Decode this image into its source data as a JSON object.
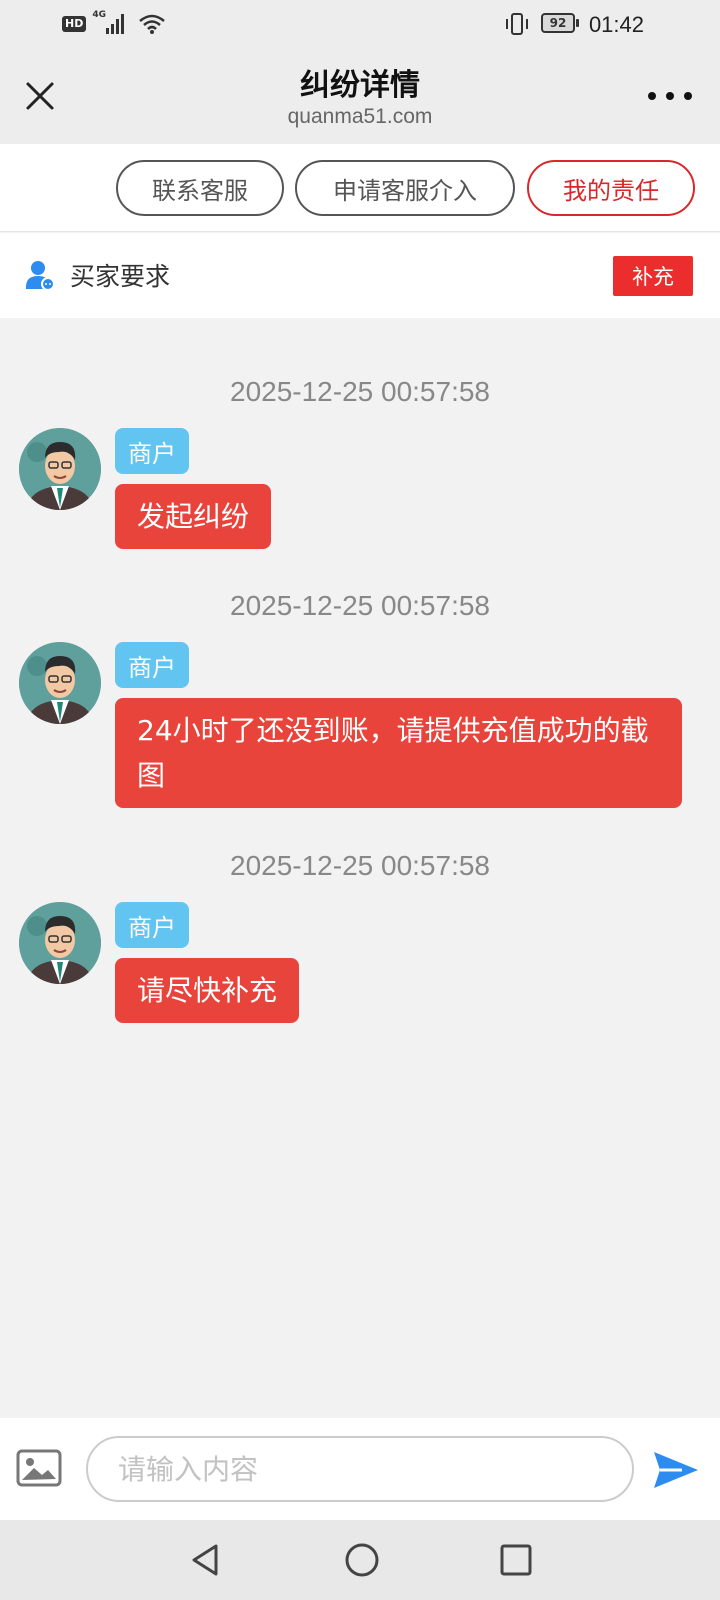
{
  "status_bar": {
    "hd_label": "HD",
    "network_label": "4G",
    "battery_level": "92",
    "time": "01:42"
  },
  "header": {
    "title": "纠纷详情",
    "subtitle": "quanma51.com"
  },
  "actions": {
    "contact_service": "联系客服",
    "request_intervention": "申请客服介入",
    "my_responsibility": "我的责任"
  },
  "buyer": {
    "label": "买家要求",
    "supplement_button": "补充"
  },
  "messages": [
    {
      "time": "2025-12-25 00:57:58",
      "role": "商户",
      "text": "发起纠纷"
    },
    {
      "time": "2025-12-25 00:57:58",
      "role": "商户",
      "text": "24小时了还没到账，请提供充值成功的截图"
    },
    {
      "time": "2025-12-25 00:57:58",
      "role": "商户",
      "text": "请尽快补充"
    }
  ],
  "input": {
    "placeholder": "请输入内容",
    "value": ""
  },
  "colors": {
    "accent_red": "#e8443b",
    "role_tag_blue": "#62c4f0",
    "send_blue": "#2d8cf0"
  },
  "icons": {
    "close": "close-icon",
    "more": "more-icon",
    "buyer": "user-icon",
    "image": "image-icon",
    "send": "send-icon",
    "nav_back": "triangle-back-icon",
    "nav_home": "circle-home-icon",
    "nav_recent": "square-recent-icon"
  }
}
